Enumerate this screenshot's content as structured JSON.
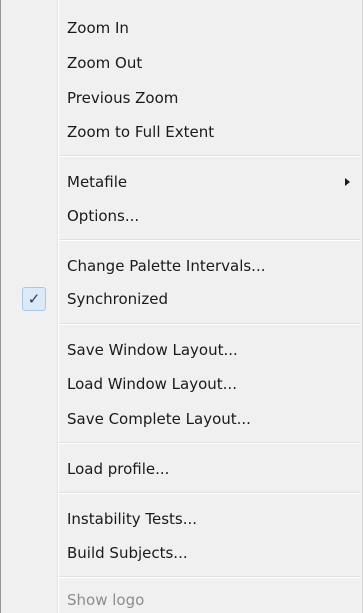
{
  "menu": {
    "zoom_in": "Zoom In",
    "zoom_out": "Zoom Out",
    "previous_zoom": "Previous Zoom",
    "zoom_full_extent": "Zoom to Full Extent",
    "metafile": "Metafile",
    "options": "Options...",
    "change_palette": "Change Palette Intervals...",
    "synchronized": "Synchronized",
    "synchronized_checked": true,
    "check_glyph": "✓",
    "save_window_layout": "Save Window Layout...",
    "load_window_layout": "Load Window Layout...",
    "save_complete_layout": "Save Complete Layout...",
    "load_profile": "Load profile...",
    "instability_tests": "Instability Tests...",
    "build_subjects": "Build Subjects...",
    "show_logo": "Show logo",
    "show_logo_enabled": false
  }
}
